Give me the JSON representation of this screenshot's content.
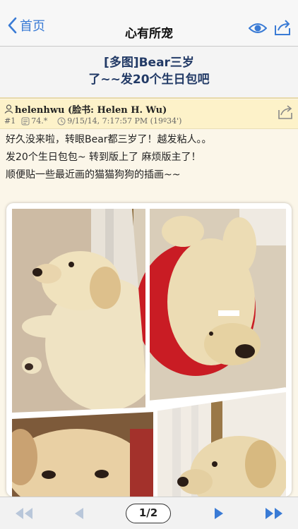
{
  "nav": {
    "back_label": "首页",
    "title": "心有所宠"
  },
  "topic": {
    "title_line1": "[多图]Bear三岁",
    "title_line2": "了~~发20个生日包吧"
  },
  "post": {
    "author": "helenhwu (脸书: Helen H. Wu)",
    "floor": "#1",
    "ip": "74.*",
    "timestamp": "9/15/14, 7:17:57 PM (19º34')",
    "body_lines": [
      "好久没来啦，转眼Bear都三岁了！越发粘人。。",
      "发20个生日包包~ 转到版上了 麻烦版主了！",
      "顺便贴一些最近画的猫猫狗狗的插画~~"
    ]
  },
  "toolbar": {
    "page_indicator": "1/2"
  },
  "colors": {
    "accent_blue": "#3a7bd5",
    "meta_bg": "#fdf2c9",
    "title_color": "#223a66"
  }
}
